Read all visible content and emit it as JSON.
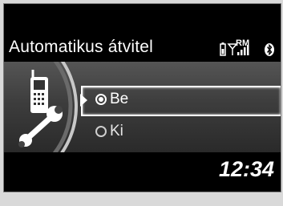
{
  "header": {
    "title": "Automatikus átvitel",
    "status_icons": [
      "battery-icon",
      "signal-icon",
      "roaming-icon",
      "bluetooth-icon"
    ],
    "roaming_label": "RM"
  },
  "menu": {
    "options": [
      {
        "label": "Be",
        "selected": true
      },
      {
        "label": "Ki",
        "selected": false
      }
    ]
  },
  "footer": {
    "clock": "12:34"
  },
  "colors": {
    "screen_bg": "#000000",
    "panel_gradient_top": "#555555",
    "text": "#ffffff",
    "frame": "#d9d9d9"
  }
}
